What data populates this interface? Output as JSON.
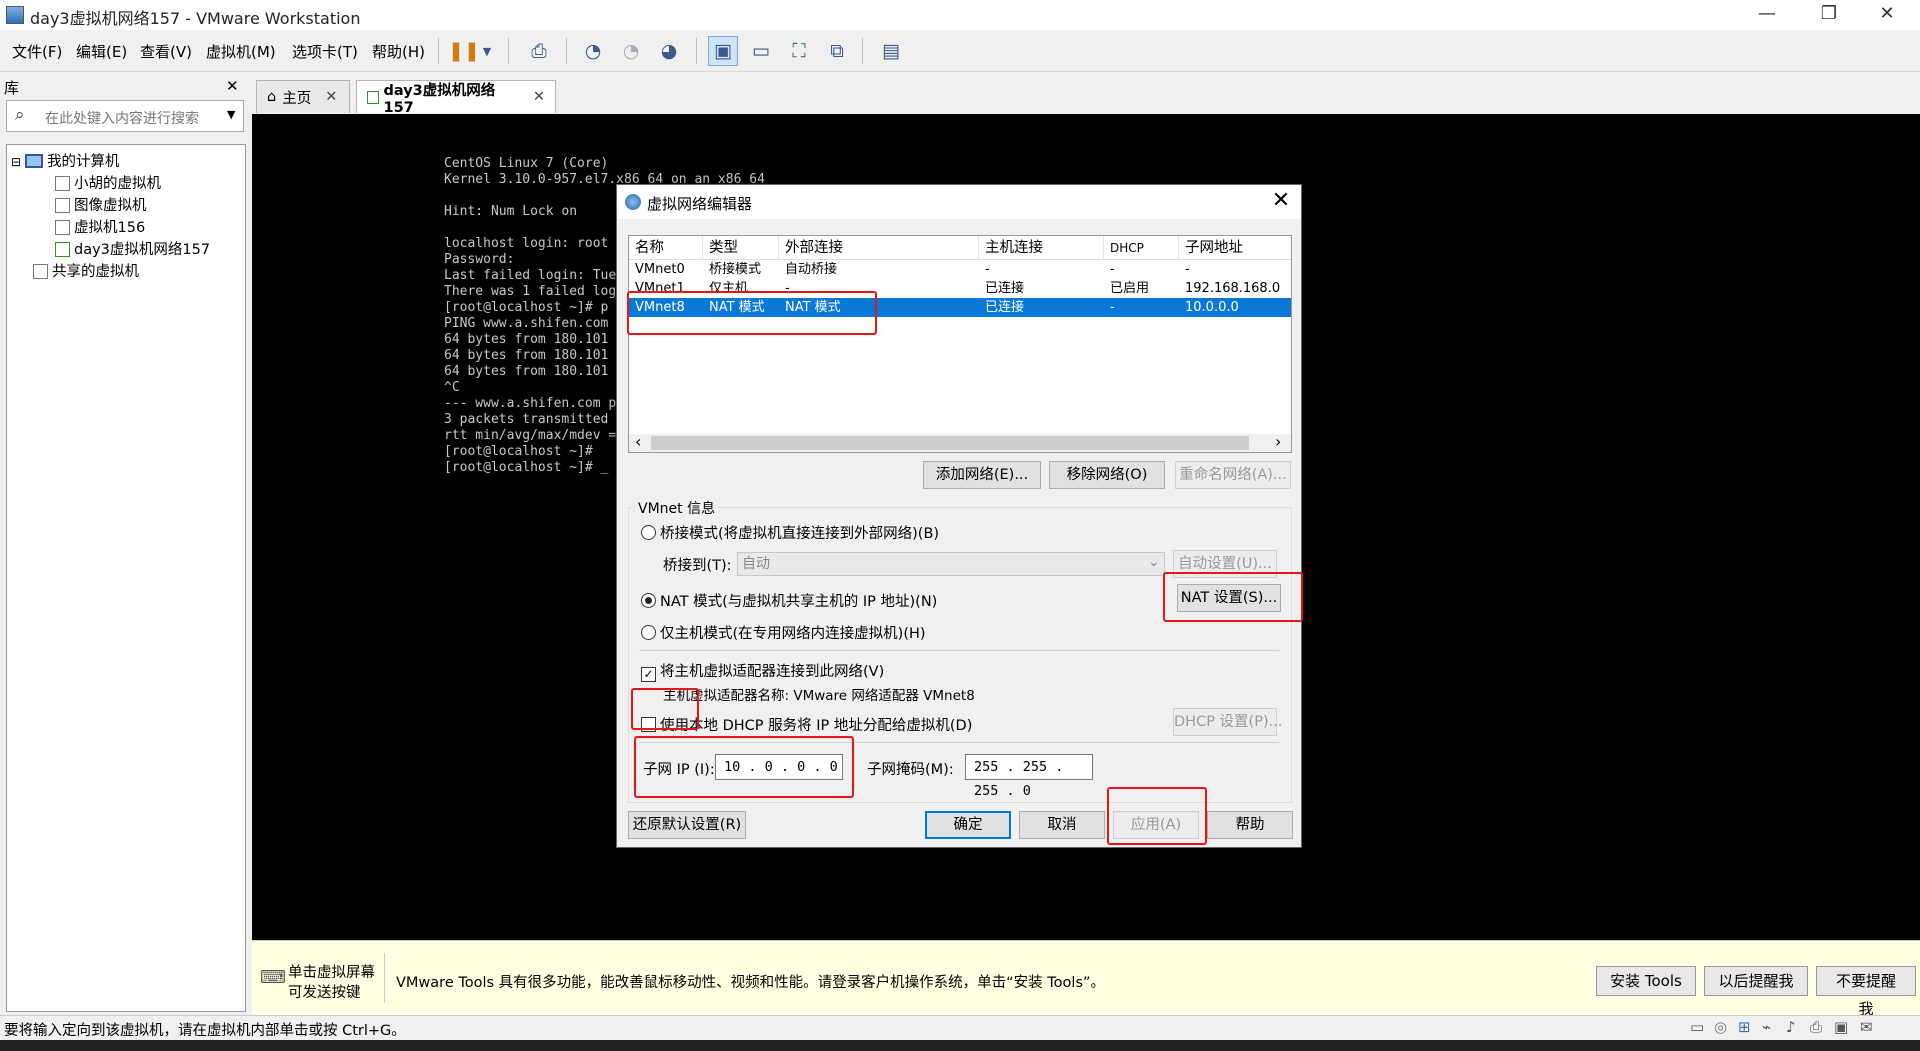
{
  "window": {
    "title": "day3虚拟机网络157 - VMware Workstation",
    "minimize": "—",
    "restore": "❐",
    "close": "✕"
  },
  "menu": [
    "文件(F)",
    "编辑(E)",
    "查看(V)",
    "虚拟机(M)",
    "选项卡(T)",
    "帮助(H)"
  ],
  "library": {
    "title": "库",
    "close": "✕",
    "search_placeholder": "在此处键入内容进行搜索",
    "root": "我的计算机",
    "vms": [
      "小胡的虚拟机",
      "图像虚拟机",
      "虚拟机156",
      "day3虚拟机网络157"
    ],
    "shared": "共享的虚拟机",
    "expander": "⊟"
  },
  "tabs": [
    {
      "label": "主页",
      "close": "✕"
    },
    {
      "label": "day3虚拟机网络157",
      "close": "✕"
    }
  ],
  "terminal": [
    "CentOS Linux 7 (Core)",
    "Kernel 3.10.0-957.el7.x86_64 on an x86_64",
    "",
    "Hint: Num Lock on",
    "",
    "localhost login: root",
    "Password:",
    "Last failed login: Tue",
    "There was 1 failed log",
    "[root@localhost ~]# p",
    "PING www.a.shifen.com",
    "64 bytes from 180.101",
    "64 bytes from 180.101",
    "64 bytes from 180.101",
    "^C",
    "--- www.a.shifen.com p",
    "3 packets transmitted",
    "rtt min/avg/max/mdev =",
    "[root@localhost ~]#",
    "[root@localhost ~]# _"
  ],
  "dialog": {
    "title": "虚拟网络编辑器",
    "close": "✕",
    "columns": [
      "名称",
      "类型",
      "外部连接",
      "主机连接",
      "DHCP",
      "子网地址"
    ],
    "rows": [
      [
        "VMnet0",
        "桥接模式",
        "自动桥接",
        "-",
        "-",
        "-"
      ],
      [
        "VMnet1",
        "仅主机",
        "-",
        "已连接",
        "已启用",
        "192.168.168.0"
      ],
      [
        "VMnet8",
        "NAT 模式",
        "NAT 模式",
        "已连接",
        "-",
        "10.0.0.0"
      ]
    ],
    "scroll_left": "‹",
    "scroll_right": "›",
    "btn_add": "添加网络(E)...",
    "btn_remove": "移除网络(O)",
    "btn_rename": "重命名网络(A)...",
    "group_title": "VMnet 信息",
    "radio_bridge": "桥接模式(将虚拟机直接连接到外部网络)(B)",
    "bridge_to_label": "桥接到(T):",
    "bridge_to_value": "自动",
    "combo_arrow": "⌄",
    "btn_auto": "自动设置(U)...",
    "radio_nat": "NAT 模式(与虚拟机共享主机的 IP 地址)(N)",
    "btn_nat": "NAT 设置(S)...",
    "radio_host": "仅主机模式(在专用网络内连接虚拟机)(H)",
    "chk_adapter": "将主机虚拟适配器连接到此网络(V)",
    "chk_mark": "✓",
    "adapter_name": "主机虚拟适配器名称: VMware 网络适配器 VMnet8",
    "chk_dhcp": "使用本地 DHCP 服务将 IP 地址分配给虚拟机(D)",
    "btn_dhcp": "DHCP 设置(P)...",
    "subnet_ip_label": "子网 IP (I):",
    "subnet_ip": "10 . 0 . 0 . 0",
    "subnet_mask_label": "子网掩码(M):",
    "subnet_mask": "255 . 255 . 255 . 0",
    "btn_restore": "还原默认设置(R)",
    "btn_ok": "确定",
    "btn_cancel": "取消",
    "btn_apply": "应用(A)",
    "btn_help": "帮助"
  },
  "tools": {
    "hint_line1": "单击虚拟屏幕",
    "hint_line2": "可发送按键",
    "message": "VMware Tools 具有很多功能，能改善鼠标移动性、视频和性能。请登录客户机操作系统，单击“安装 Tools”。",
    "btn_install": "安装 Tools",
    "btn_later": "以后提醒我",
    "btn_never": "不要提醒我"
  },
  "status": {
    "text": "要将输入定向到该虚拟机，请在虚拟机内部单击或按 Ctrl+G。"
  },
  "colors": {
    "selection": "#0a78d7",
    "highlight": "#e8161b",
    "console": "#000000",
    "tools_bar": "#ffffe1"
  }
}
